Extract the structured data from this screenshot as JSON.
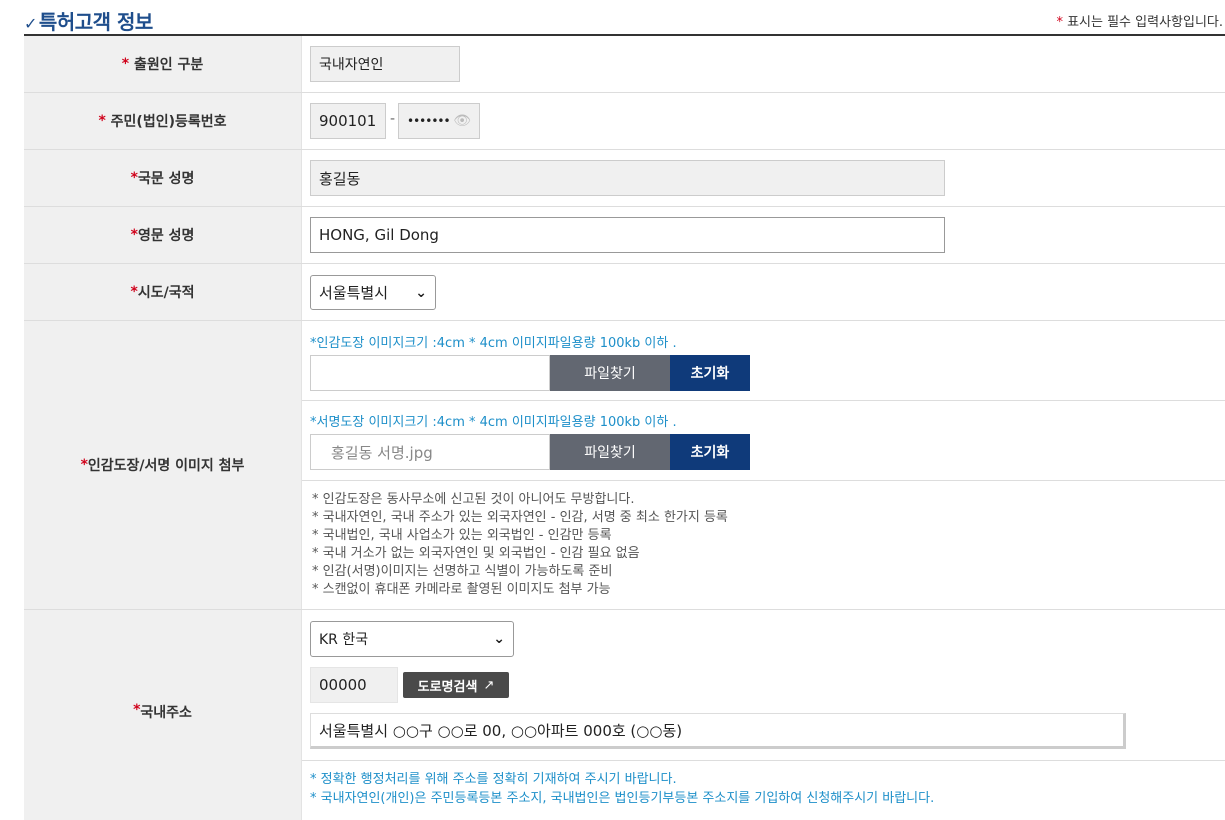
{
  "header": {
    "title": "특허고객 정보",
    "required_note_star": "*",
    "required_note": "표시는 필수 입력사항입니다."
  },
  "fields": {
    "applicant_type": {
      "label": "출원인 구분",
      "value": "국내자연인"
    },
    "resident_no": {
      "label": "주민(법인)등록번호",
      "front": "900101",
      "separator": "-",
      "back_masked": "•••••••"
    },
    "korean_name": {
      "label": "국문 성명",
      "value": "홍길동"
    },
    "english_name": {
      "label": "영문 성명",
      "value": "HONG, Gil Dong"
    },
    "region": {
      "label": "시도/국적",
      "selected": "서울특별시"
    },
    "seal": {
      "label": "인감도장/서명 이미지 첨부",
      "seal_hint": "*인감도장 이미지크기 :4cm * 4cm 이미지파일용량 100kb 이하 .",
      "seal_file": "",
      "sign_hint": "*서명도장 이미지크기 :4cm * 4cm 이미지파일용량 100kb 이하 .",
      "sign_file": "홍길동 서명.jpg",
      "find_label": "파일찾기",
      "reset_label": "초기화",
      "notes": [
        "* 인감도장은 동사무소에 신고된 것이 아니어도 무방합니다.",
        "* 국내자연인, 국내 주소가 있는 외국자연인 - 인감, 서명 중 최소 한가지 등록",
        "* 국내법인, 국내 사업소가 있는 외국법인 - 인감만 등록",
        "* 국내 거소가 없는 외국자연인 및 외국법인 - 인감 필요 없음",
        "* 인감(서명)이미지는 선명하고 식별이 가능하도록 준비",
        "* 스캔없이 휴대폰 카메라로 촬영된 이미지도 첨부 가능"
      ]
    },
    "address": {
      "label": "국내주소",
      "country": "KR 한국",
      "zip": "00000",
      "road_search": "도로명검색",
      "address_text": "서울특별시 ○○구 ○○로 00, ○○아파트 000호 (○○동)",
      "notes": [
        "* 정확한 행정처리를 위해 주소를 정확히 기재하여 주시기 바랍니다.",
        "* 국내자연인(개인)은 주민등록등본 주소지, 국내법인은 법인등기부등본 주소지를 기입하여 신청해주시기 바랍니다."
      ]
    }
  }
}
